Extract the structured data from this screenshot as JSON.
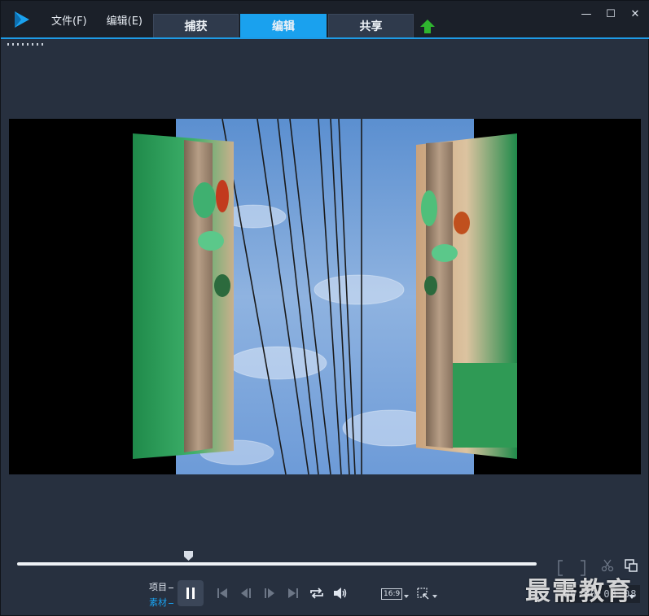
{
  "menu": {
    "file": "文件(F)",
    "edit": "编辑(E)"
  },
  "tabs": [
    {
      "label": "捕获",
      "active": false
    },
    {
      "label": "编辑",
      "active": true
    },
    {
      "label": "共享",
      "active": false
    }
  ],
  "window_controls": {
    "minimize": "—",
    "maximize": "☐",
    "close": "✕"
  },
  "player": {
    "progress": 0.33,
    "mode_project": "项目",
    "mode_clip": "素材",
    "active_mode": "clip",
    "aspect_ratio": "16:9",
    "timecode": "00:00:03:08"
  },
  "watermark": "最需教育",
  "colors": {
    "accent": "#1aa1ee",
    "titlebar": "#1b2029",
    "panel": "#27303f",
    "upload_arrow": "#2fb52f"
  },
  "icons": [
    "app-logo-icon",
    "upload-icon",
    "play-pause-icon",
    "skip-start-icon",
    "prev-frame-icon",
    "next-frame-icon",
    "skip-end-icon",
    "repeat-icon",
    "volume-icon",
    "crop-icon",
    "scissors-icon",
    "popout-icon"
  ]
}
